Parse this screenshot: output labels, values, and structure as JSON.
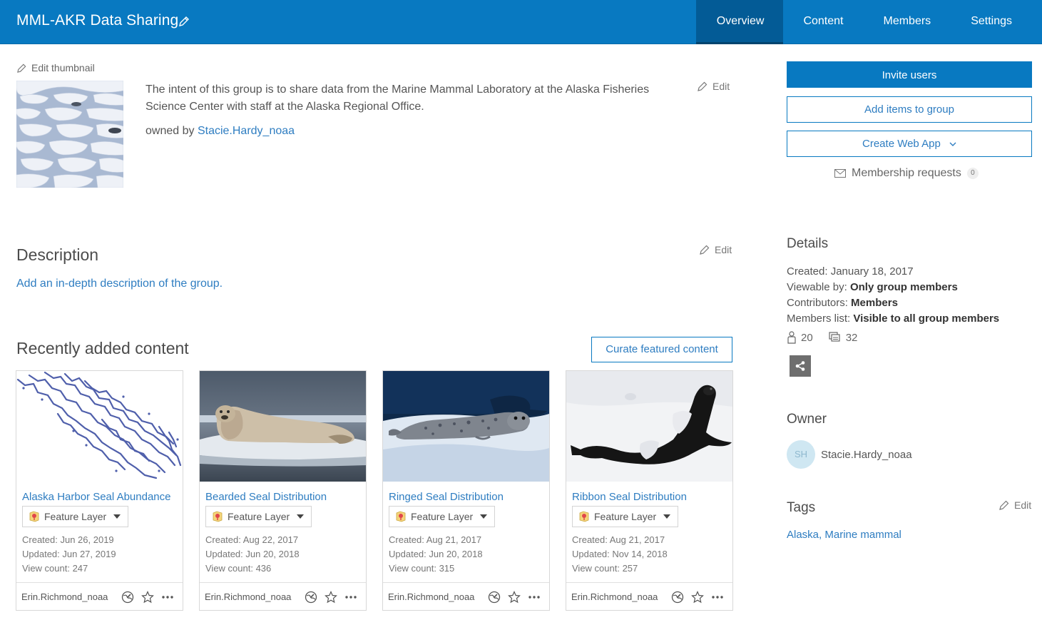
{
  "header": {
    "title": "MML-AKR Data Sharing",
    "tabs": [
      {
        "label": "Overview",
        "active": true
      },
      {
        "label": "Content",
        "active": false
      },
      {
        "label": "Members",
        "active": false
      },
      {
        "label": "Settings",
        "active": false
      }
    ]
  },
  "colors": {
    "brand": "#0879c1",
    "link": "#2e7dc1",
    "tab_active": "#035b96"
  },
  "intro": {
    "edit_thumbnail": "Edit thumbnail",
    "summary": "The intent of this group is to share data from the Marine Mammal Laboratory at the Alaska Fisheries Science Center with staff at the Alaska Regional Office.",
    "owned_by_prefix": "owned by",
    "owner_link": "Stacie.Hardy_noaa",
    "edit_label": "Edit"
  },
  "actions": {
    "invite": "Invite users",
    "add_items": "Add items to group",
    "create_web_app": "Create Web App",
    "membership_requests": "Membership requests",
    "membership_count": "0"
  },
  "description": {
    "heading": "Description",
    "edit_label": "Edit",
    "add_link": "Add an in-depth description of the group."
  },
  "recent": {
    "heading": "Recently added content",
    "curate": "Curate featured content",
    "cards": [
      {
        "title": "Alaska Harbor Seal Abundance",
        "type": "Feature Layer",
        "created": "Created: Jun 26, 2019",
        "updated": "Updated: Jun 27, 2019",
        "views": "View count: 247",
        "owner": "Erin.Richmond_noaa",
        "image": "map"
      },
      {
        "title": "Bearded Seal Distribution",
        "type": "Feature Layer",
        "created": "Created: Aug 22, 2017",
        "updated": "Updated: Jun 20, 2018",
        "views": "View count: 436",
        "owner": "Erin.Richmond_noaa",
        "image": "bearded"
      },
      {
        "title": "Ringed Seal Distribution",
        "type": "Feature Layer",
        "created": "Created: Aug 21, 2017",
        "updated": "Updated: Jun 20, 2018",
        "views": "View count: 315",
        "owner": "Erin.Richmond_noaa",
        "image": "ringed"
      },
      {
        "title": "Ribbon Seal Distribution",
        "type": "Feature Layer",
        "created": "Created: Aug 21, 2017",
        "updated": "Updated: Nov 14, 2018",
        "views": "View count: 257",
        "owner": "Erin.Richmond_noaa",
        "image": "ribbon"
      }
    ]
  },
  "details": {
    "heading": "Details",
    "created": "Created: January 18, 2017",
    "viewable_label": "Viewable by:",
    "viewable_value": "Only group members",
    "contributors_label": "Contributors:",
    "contributors_value": "Members",
    "members_list_label": "Members list:",
    "members_list_value": "Visible to all group members",
    "member_count": "20",
    "item_count": "32"
  },
  "owner": {
    "heading": "Owner",
    "initials": "SH",
    "name": "Stacie.Hardy_noaa"
  },
  "tags": {
    "heading": "Tags",
    "edit_label": "Edit",
    "items": [
      {
        "label": "Alaska",
        "sep": ", "
      },
      {
        "label": "Marine mammal",
        "sep": ""
      }
    ]
  }
}
